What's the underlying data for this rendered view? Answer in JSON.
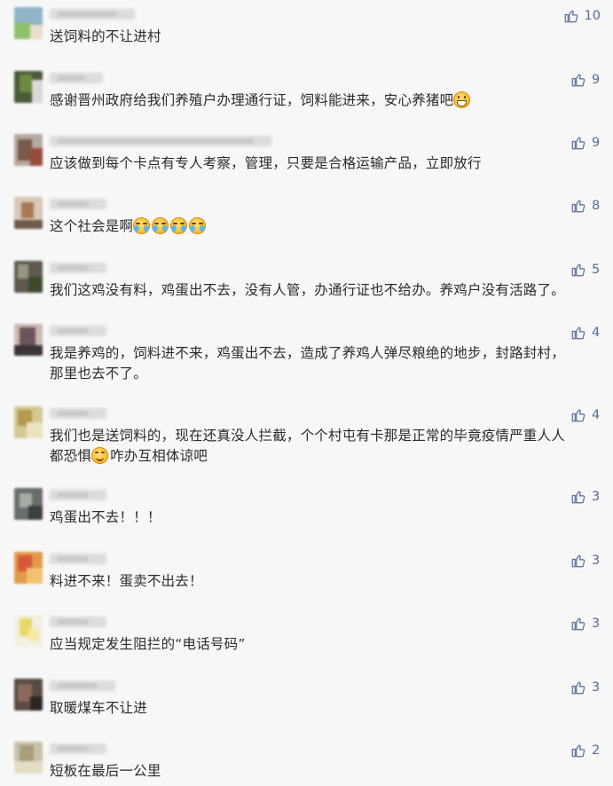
{
  "comments": [
    {
      "text": "送饲料的不让进村",
      "emoji": [],
      "likes": "10"
    },
    {
      "text": "感谢晋州政府给我们养殖户办理通行证，饲料能进来，安心养猪吧",
      "emoji": [
        "grin"
      ],
      "likes": "9"
    },
    {
      "text": "应该做到每个卡点有专人考察，管理，只要是合格运输产品，立即放行",
      "emoji": [],
      "likes": "9"
    },
    {
      "text": "这个社会是啊",
      "emoji": [
        "cry",
        "cry",
        "cry",
        "cry"
      ],
      "likes": "8"
    },
    {
      "text": "我们这鸡没有料，鸡蛋出不去，没有人管，办通行证也不给办。养鸡户没有活路了。",
      "emoji": [],
      "likes": "5"
    },
    {
      "text": "我是养鸡的，饲料进不来，鸡蛋出不去，造成了养鸡人弹尽粮绝的地步，封路封村，\n那里也去不了。",
      "emoji": [],
      "likes": "4"
    },
    {
      "text": "我们也是送饲料的，现在还真没人拦截，个个村屯有卡那是正常的毕竟疫情严重人人\n都恐惧",
      "text_after": "咋办互相体谅吧",
      "emoji": [
        "smile"
      ],
      "likes": "4"
    },
    {
      "text": "鸡蛋出不去！！！",
      "emoji": [],
      "likes": "3"
    },
    {
      "text": "料进不来！蛋卖不出去！",
      "emoji": [],
      "likes": "3"
    },
    {
      "text": "应当规定发生阻拦的“电话号码”",
      "emoji": [],
      "likes": "3"
    },
    {
      "text": "取暖煤车不让进",
      "emoji": [],
      "likes": "3"
    },
    {
      "text": "短板在最后一公里",
      "emoji": [],
      "likes": "2"
    }
  ],
  "icons": {
    "like": "thumbs-up-icon",
    "emoji_grin": "grinning-face-icon",
    "emoji_cry": "crying-laughing-face-icon",
    "emoji_smile": "smiling-face-icon"
  },
  "colors": {
    "background": "#f7f7f7",
    "text": "#2b2b2b",
    "like": "#576b95"
  }
}
